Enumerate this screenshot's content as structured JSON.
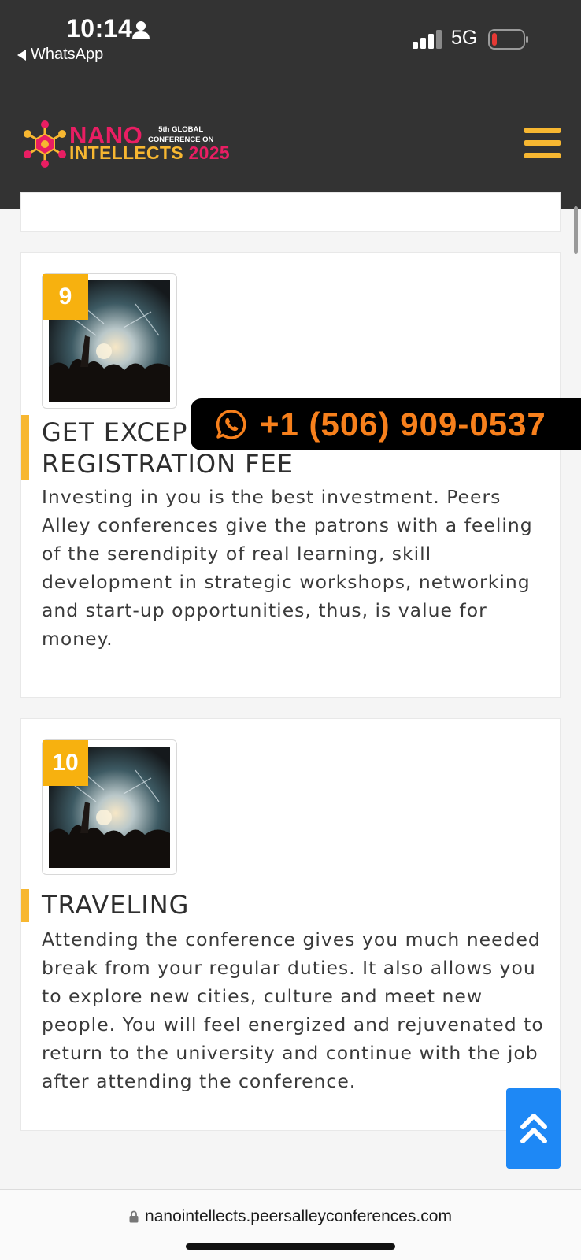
{
  "status_bar": {
    "time": "10:14",
    "back_app": "WhatsApp",
    "network": "5G"
  },
  "header": {
    "logo": {
      "line1": "NANO",
      "line2": "INTELLECTS",
      "year": "2025",
      "small_line1": "5th GLOBAL",
      "small_line2": "CONFERENCE ON"
    },
    "menu_icon": "hamburger-icon",
    "brand_colors": {
      "pink": "#e91e63",
      "gold": "#f7b731",
      "dark": "#333333"
    }
  },
  "cards": [
    {
      "number": "9",
      "title_line1": "GET EXCEP",
      "title_line2": "REGISTRATION FEE",
      "description": "Investing in you is the best investment. Peers Alley conferences give the patrons with a feeling of the serendipity of real learning, skill development in strategic workshops, networking and start-up opportunities, thus, is value for money."
    },
    {
      "number": "10",
      "title_line1": "TRAVELING",
      "description": "Attending the conference gives you much needed break from your regular duties. It also allows you to explore new cities, culture and meet new people. You will feel energized and rejuvenated to return to the university and continue with the job after attending the conference."
    }
  ],
  "whatsapp_banner": {
    "icon": "whatsapp-icon",
    "phone": "+1 (506) 909-0537",
    "color": "#f7801c"
  },
  "back_to_top": {
    "icon": "double-chevron-up-icon",
    "color": "#1e88f5"
  },
  "browser": {
    "url": "nanointellects.peersalleyconferences.com",
    "lock_icon": "lock-icon"
  }
}
